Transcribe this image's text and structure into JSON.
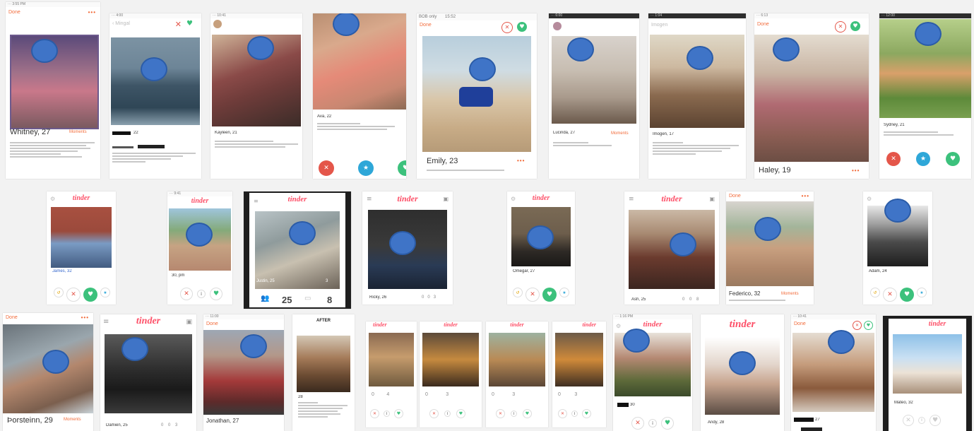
{
  "texts": {
    "done": "Done",
    "tinder": "tinder",
    "moments": "Moments",
    "dots": "•••",
    "after": "AFTER"
  },
  "row1": [
    {
      "name": "Whitney, 27"
    },
    {
      "name": "22"
    },
    {
      "name": "Kayleen, 21"
    },
    {
      "name": "Ava, 22"
    },
    {
      "name": "Emily, 23",
      "carrier": "BOB only",
      "time": "15:52"
    },
    {
      "name": "Lucinda, 27"
    },
    {
      "name": "Imogen, 17",
      "header": "Imogen"
    },
    {
      "name": "Haley, 19"
    },
    {
      "name": "Sydney, 21"
    }
  ],
  "row2": [
    {
      "name": "James, 32"
    },
    {
      "name": "30, pm"
    },
    {
      "name": "Justin, 25",
      "stat1": "25",
      "stat2": "8",
      "badge": "3"
    },
    {
      "name": "Ricky, 26",
      "counts": [
        "0",
        "0",
        "3"
      ]
    },
    {
      "name": "Omegar, 27"
    },
    {
      "name": "Ash, 25",
      "counts": [
        "0",
        "0",
        "8"
      ]
    },
    {
      "name": "Federico, 32"
    },
    {
      "name": "Adam, 24"
    }
  ],
  "row3": [
    {
      "name": "Þorsteinn, 29"
    },
    {
      "name": "Damien, 25",
      "counts": [
        "0",
        "0",
        "3"
      ]
    },
    {
      "name": "Jonathan, 27"
    },
    {
      "name": "28"
    },
    {
      "name": "",
      "counts": [
        "0",
        "4"
      ]
    },
    {
      "name": "",
      "counts": [
        "0",
        "3"
      ]
    },
    {
      "name": "",
      "counts": [
        "0",
        "3"
      ]
    },
    {
      "name": "",
      "counts": [
        "0",
        "3"
      ]
    },
    {
      "name": "30"
    },
    {
      "name": "Andy, 28"
    },
    {
      "name": "27"
    },
    {
      "name": "Mateo, 32"
    }
  ]
}
